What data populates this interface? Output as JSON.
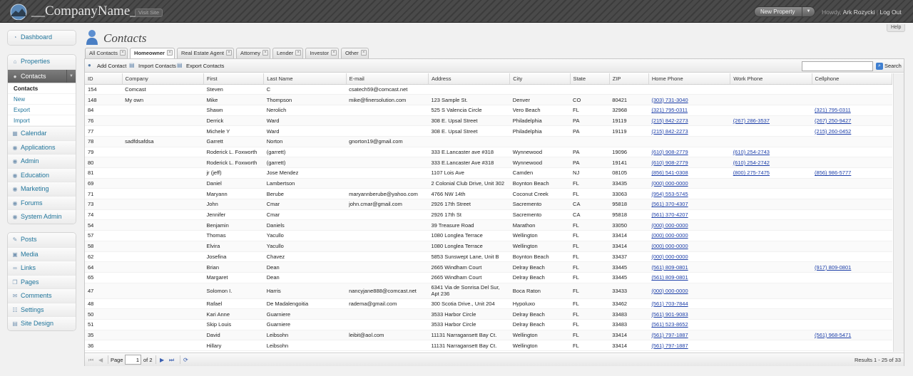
{
  "header": {
    "site_name": "__CompanyName__",
    "visit_site": "Visit Site",
    "new_property": "New Property",
    "howdy_prefix": "Howdy,",
    "user": "Ark Rozycki",
    "separator": "|",
    "logout": "Log Out",
    "help": "Help"
  },
  "sidebar": {
    "group1": [
      {
        "label": "Dashboard",
        "icon": "dashboard-icon"
      }
    ],
    "group2": [
      {
        "label": "Properties",
        "icon": "properties-icon"
      },
      {
        "label": "Contacts",
        "icon": "contacts-icon"
      }
    ],
    "contacts_submenu": [
      "Contacts",
      "New",
      "Export",
      "Import"
    ],
    "group2b": [
      {
        "label": "Calendar",
        "icon": "calendar-icon"
      },
      {
        "label": "Applications",
        "icon": "applications-icon"
      },
      {
        "label": "Admin",
        "icon": "admin-icon"
      },
      {
        "label": "Education",
        "icon": "education-icon"
      },
      {
        "label": "Marketing",
        "icon": "marketing-icon"
      },
      {
        "label": "Forums",
        "icon": "forums-icon"
      },
      {
        "label": "System Admin",
        "icon": "system-admin-icon"
      }
    ],
    "group3": [
      {
        "label": "Posts",
        "icon": "posts-icon"
      },
      {
        "label": "Media",
        "icon": "media-icon"
      },
      {
        "label": "Links",
        "icon": "links-icon"
      },
      {
        "label": "Pages",
        "icon": "pages-icon"
      },
      {
        "label": "Comments",
        "icon": "comments-icon"
      },
      {
        "label": "Settings",
        "icon": "settings-icon"
      },
      {
        "label": "Site Design",
        "icon": "site-design-icon"
      }
    ]
  },
  "page_title": "Contacts",
  "tabs": [
    "All Contacts",
    "Homeowner",
    "Real Estate Agent",
    "Attorney",
    "Lender",
    "Investor",
    "Other"
  ],
  "selected_tab": "Homeowner",
  "toolbar": {
    "add": "Add Contact",
    "import": "Import Contacts",
    "export": "Export Contacts",
    "search_value": "",
    "search": "Search"
  },
  "columns": [
    "ID",
    "Company",
    "First",
    "Last Name",
    "E-mail",
    "Address",
    "City",
    "State",
    "ZIP",
    "Home Phone",
    "Work Phone",
    "Cellphone"
  ],
  "rows": [
    [
      "154",
      "Comcast",
      "Steven",
      "C",
      "csatech59@comcast.net",
      "",
      "",
      "",
      "",
      "",
      "",
      ""
    ],
    [
      "148",
      "My own",
      "Mike",
      "Thompson",
      "mike@finersolution.com",
      "123 Sample St.",
      "Denver",
      "CO",
      "80421",
      "(303) 731-3040",
      "",
      ""
    ],
    [
      "84",
      "",
      "Shawn",
      "Nerolich",
      "",
      "525 S Valencia Circle",
      "Vero Beach",
      "FL",
      "32968",
      "(321) 795-0311",
      "",
      "(321) 795-0311"
    ],
    [
      "76",
      "",
      "Derrick",
      "Ward",
      "",
      "308 E. Upsal Street",
      "Philadelphia",
      "PA",
      "19119",
      "(215) 842-2273",
      "(267) 286-3537",
      "(267) 250-9427"
    ],
    [
      "77",
      "",
      "Michele Y",
      "Ward",
      "",
      "308 E. Upsal Street",
      "Philadelphia",
      "PA",
      "19119",
      "(215) 842-2273",
      "",
      "(215) 260-0452"
    ],
    [
      "78",
      "sadfdsafdsa",
      "Garrett",
      "Norton",
      "gnorton19@gmail.com",
      "",
      "",
      "",
      "",
      "",
      "",
      ""
    ],
    [
      "79",
      "",
      "Roderick L. Foxworth",
      "(garrett)",
      "",
      "333 E.Lancaster ave #318",
      "Wynnewood",
      "PA",
      "19096",
      "(610) 908-2779",
      "(610) 254-2743",
      ""
    ],
    [
      "80",
      "",
      "Roderick L. Foxworth",
      "(garrett)",
      "",
      "333 E.Lancaster Ave #318",
      "Wynnewood",
      "PA",
      "19141",
      "(610) 908-2779",
      "(610) 254-2742",
      ""
    ],
    [
      "81",
      "",
      "jr (jeff)",
      "Jose Mendez",
      "",
      "1107 Lois Ave",
      "Camden",
      "NJ",
      "08105",
      "(856) 541-0308",
      "(800) 275-7475",
      "(856) 986-5777"
    ],
    [
      "69",
      "",
      "Daniel",
      "Lambertson",
      "",
      "2 Colonial Club Drive, Unit 302",
      "Boynton Beach",
      "FL",
      "33435",
      "(000) 000-0000",
      "",
      ""
    ],
    [
      "71",
      "",
      "Maryann",
      "Berube",
      "maryannberube@yahoo.com",
      "4766 NW 14th",
      "Coconut Creek",
      "FL",
      "33063",
      "(954) 553-5745",
      "",
      ""
    ],
    [
      "73",
      "",
      "John",
      "Cmar",
      "john.cmar@gmail.com",
      "2926 17th Street",
      "Sacremento",
      "CA",
      "95818",
      "(561) 370-4307",
      "",
      ""
    ],
    [
      "74",
      "",
      "Jennifer",
      "Cmar",
      "",
      "2926 17th St",
      "Sacremento",
      "CA",
      "95818",
      "(561) 370-4207",
      "",
      ""
    ],
    [
      "54",
      "",
      "Benjamin",
      "Daniels",
      "",
      "39 Treasure Road",
      "Marathon",
      "FL",
      "33050",
      "(000) 000-0000",
      "",
      ""
    ],
    [
      "57",
      "",
      "Thomas",
      "Yacullo",
      "",
      "1080 Longlea Terrace",
      "Wellington",
      "FL",
      "33414",
      "(000) 000-0000",
      "",
      ""
    ],
    [
      "58",
      "",
      "Elvira",
      "Yacullo",
      "",
      "1080 Longlea Terrace",
      "Wellington",
      "FL",
      "33414",
      "(000) 000-0000",
      "",
      ""
    ],
    [
      "62",
      "",
      "Josefina",
      "Chavez",
      "",
      "5853 Sunswept Lane, Unit B",
      "Boynton Beach",
      "FL",
      "33437",
      "(000) 000-0000",
      "",
      ""
    ],
    [
      "64",
      "",
      "Brian",
      "Dean",
      "",
      "2665 Windham Court",
      "Delray Beach",
      "FL",
      "33445",
      "(561) 809-0801",
      "",
      "(917) 809-0801"
    ],
    [
      "65",
      "",
      "Margaret",
      "Dean",
      "",
      "2665 Windham Court",
      "Delray Beach",
      "FL",
      "33445",
      "(561) 809-0801",
      "",
      ""
    ],
    [
      "47",
      "",
      "Solomon I.",
      "Harris",
      "nancyjane888@comcast.net",
      "6341 Via de Sonrisa Del Sur, Apt 236",
      "Boca Raton",
      "FL",
      "33433",
      "(000) 000-0000",
      "",
      ""
    ],
    [
      "48",
      "",
      "Rafael",
      "De Madalengoitia",
      "radema@gmail.com",
      "300 Scotia Drive., Unit 204",
      "Hypoluxo",
      "FL",
      "33462",
      "(561) 703-7844",
      "",
      ""
    ],
    [
      "50",
      "",
      "Kari Anne",
      "Guarniere",
      "",
      "3533 Harbor Circle",
      "Delray Beach",
      "FL",
      "33483",
      "(561) 901-9083",
      "",
      ""
    ],
    [
      "51",
      "",
      "Skip Louis",
      "Guarniere",
      "",
      "3533 Harbor Circle",
      "Delray Beach",
      "FL",
      "33483",
      "(561) 523-8652",
      "",
      ""
    ],
    [
      "35",
      "",
      "David",
      "Leibsohn",
      "leibit@aol.com",
      "11131 Narragansett Bay Ct.",
      "Wellington",
      "FL",
      "33414",
      "(561) 797-1887",
      "",
      "(561) 968-5471"
    ],
    [
      "36",
      "",
      "Hillary",
      "Leibsohn",
      "",
      "11131 Narragansett Bay Ct.",
      "Wellington",
      "FL",
      "33414",
      "(561) 797-1887",
      "",
      ""
    ]
  ],
  "pager": {
    "page_label": "Page",
    "page": "1",
    "of": "of 2",
    "results": "Results 1 - 25 of 33"
  }
}
